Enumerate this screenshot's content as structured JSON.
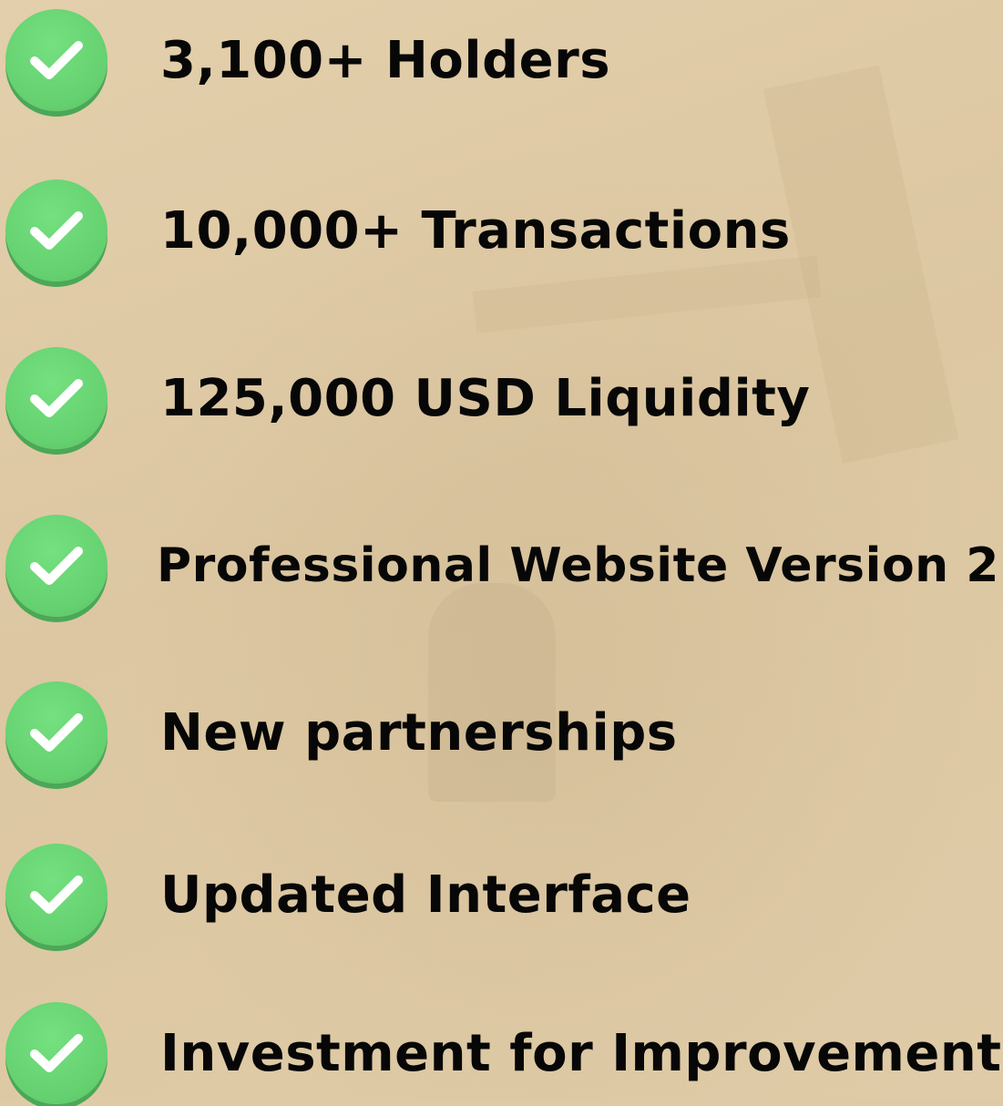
{
  "items": [
    {
      "label": "3,100+ Holders",
      "icon": "check-icon"
    },
    {
      "label": "10,000+ Transactions",
      "icon": "check-icon"
    },
    {
      "label": "125,000 USD Liquidity",
      "icon": "check-icon"
    },
    {
      "label": "Professional Website Version 2",
      "icon": "check-icon"
    },
    {
      "label": "New partnerships",
      "icon": "check-icon"
    },
    {
      "label": "Updated Interface",
      "icon": "check-icon"
    },
    {
      "label": "Investment for Improvements",
      "icon": "check-icon"
    }
  ],
  "colors": {
    "background": "#dfcaa6",
    "check_fill": "#64d06f",
    "text": "#070707"
  }
}
